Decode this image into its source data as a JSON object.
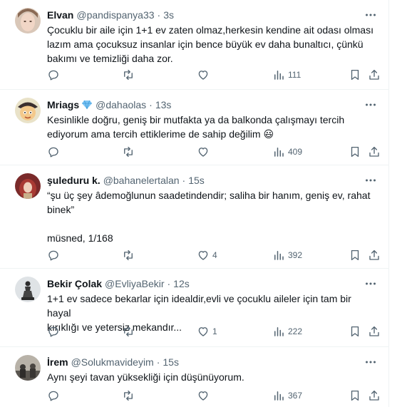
{
  "colors": {
    "text": "#0f1419",
    "muted": "#536471",
    "border": "#eff3f4"
  },
  "tweets": [
    {
      "name": "Elvan",
      "handle": "@pandispanya33",
      "time": "3s",
      "lines": [
        "Çocuklu bir aile için 1+1 ev zaten olmaz,herkesin kendine ait odası olması",
        "lazım ama çocuksuz insanlar için bence büyük ev daha bunaltıcı, çünkü",
        "bakımı ve  temizliği daha zor."
      ],
      "likes": "",
      "views": "111",
      "verified": false
    },
    {
      "name": "Mriags",
      "handle": "@dahaolas",
      "time": "13s",
      "lines": [
        "Kesinlikle doğru, geniş bir mutfakta ya da balkonda çalışmayı tercih",
        "ediyorum ama tercih ettiklerime de sahip değilim 😃"
      ],
      "likes": "",
      "views": "409",
      "verified": true
    },
    {
      "name": "şuleduru k.",
      "handle": "@bahanelertalan",
      "time": "15s",
      "lines": [
        "“şu üç şey âdemoğlunun saadetindendir; saliha bir hanım, geniş ev, rahat",
        "binek”",
        "",
        "müsned, 1/168"
      ],
      "likes": "4",
      "views": "392",
      "verified": false
    },
    {
      "name": "Bekir Çolak",
      "handle": "@EvliyaBekir",
      "time": "12s",
      "lines": [
        "1+1 ev sadece bekarlar için idealdir,evli ve çocuklu aileler için tam bir hayal",
        "kırıklığı ve yetersiz mekandır..."
      ],
      "likes": "1",
      "views": "222",
      "verified": false
    },
    {
      "name": "İrem",
      "handle": "@Solukmavideyim",
      "time": "15s",
      "lines": [
        "Aynı şeyi tavan yüksekliği için düşünüyorum."
      ],
      "likes": "",
      "views": "367",
      "verified": false
    }
  ]
}
